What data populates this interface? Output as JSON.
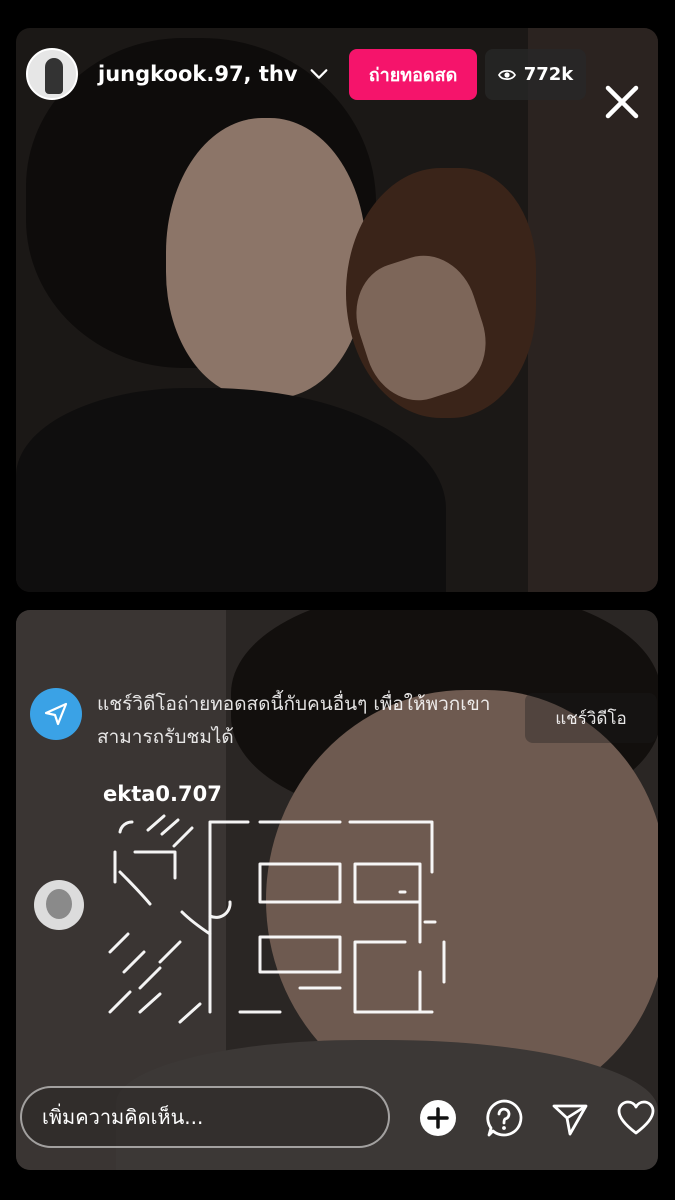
{
  "header": {
    "host_names": "jungkook.97, thv",
    "live_label": "ถ่ายทอดสด",
    "viewer_count": "772k",
    "icons": {
      "avatar": "avatar",
      "dropdown": "chevron-down-icon",
      "viewers": "eye-icon",
      "close": "close-icon"
    }
  },
  "share_prompt": {
    "text": "แชร์วิดีโอถ่ายทอดสดนี้กับคนอื่นๆ เพื่อให้พวกเขาสามารถรับชมได้",
    "button_label": "แชร์วิดีโอ",
    "icon": "send-icon"
  },
  "comment": {
    "username": "ekta0.707"
  },
  "bottom_bar": {
    "comment_placeholder": "เพิ่มความคิดเห็น...",
    "icons": [
      "add-icon",
      "question-icon",
      "send-icon",
      "heart-icon"
    ]
  },
  "colors": {
    "live_badge": "#f5146b",
    "share_icon_bg": "#3aa2e6"
  }
}
